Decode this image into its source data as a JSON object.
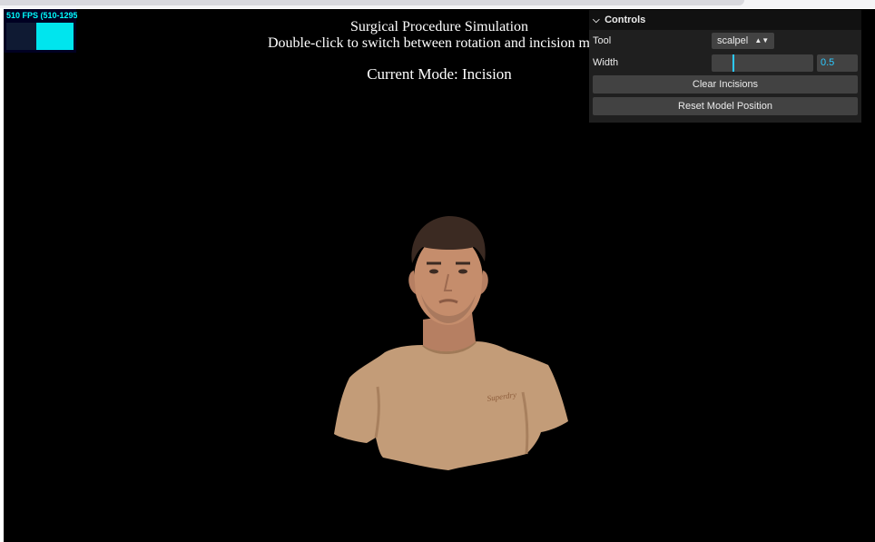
{
  "stats": {
    "fps_text": "510 FPS (510-1295)",
    "graph_level": 0.98
  },
  "info": {
    "title": "Surgical Procedure Simulation",
    "instruction": "Double-click to switch between rotation and incision mode",
    "mode_text": "Current Mode: Incision"
  },
  "controls": {
    "title": "Controls",
    "tool_label": "Tool",
    "tool_value": "scalpel",
    "width_label": "Width",
    "width_value": "0.5",
    "width_fraction": 0.21,
    "clear_label": "Clear Incisions",
    "reset_label": "Reset Model Position"
  },
  "colors": {
    "background": "#000000",
    "accent": "#2cc9ff",
    "stats_fg": "#00ffff",
    "panel": "#1f1f1f",
    "shirt": "#c09a74",
    "skin": "#c68f6e",
    "hair": "#3a2a22"
  },
  "icons": {
    "collapse": "chevron-down-icon",
    "select": "up-down-arrows-icon"
  },
  "model": {
    "subject": "3d-scanned-person-model",
    "shirt_logo": "Superdry"
  }
}
